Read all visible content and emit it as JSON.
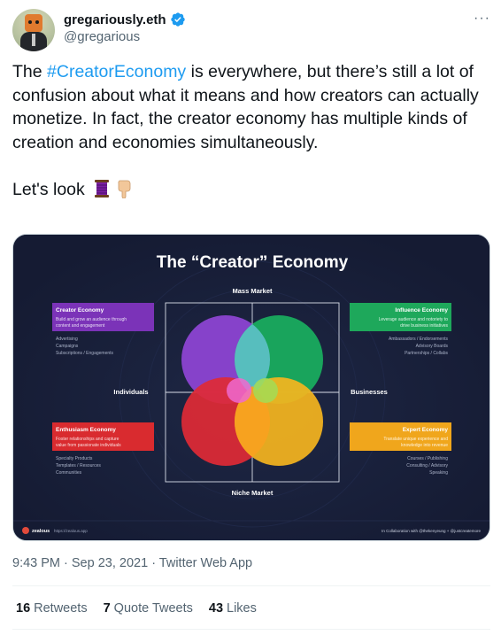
{
  "user": {
    "display_name": "gregariously.eth",
    "handle": "@gregarious"
  },
  "tweet": {
    "text_before": "The ",
    "hashtag": "#CreatorEconomy",
    "text_after": " is everywhere, but there’s still a lot of confusion about what it means and how creators can actually monetize.   In fact, the creator economy has multiple kinds of creation and economies simultaneously.",
    "closing": "Let's look"
  },
  "graphic": {
    "title": "The “Creator” Economy",
    "axis_top": "Mass Market",
    "axis_bottom": "Niche Market",
    "axis_left": "Individuals",
    "axis_right": "Businesses",
    "quadrants": {
      "top_left": {
        "title": "Creator Economy",
        "desc": [
          "Build and grow an audience through",
          "content and engagement"
        ],
        "items": [
          "Advertising",
          "Campaigns",
          "Subscriptions / Engagements"
        ],
        "color": "#7b33b8"
      },
      "top_right": {
        "title": "Influence Economy",
        "desc": [
          "Leverage audience and notoriety to",
          "drive business initiatives"
        ],
        "items": [
          "Ambassadors / Endorsements",
          "Advisory Boards",
          "Partnerships / Collabs"
        ],
        "color": "#1ea85b"
      },
      "bottom_left": {
        "title": "Enthusiasm Economy",
        "desc": [
          "Foster relationships and capture",
          "value from passionate individuals"
        ],
        "items": [
          "Specialty Products",
          "Templates / Resources",
          "Communities"
        ],
        "color": "#d92b2f"
      },
      "bottom_right": {
        "title": "Expert Economy",
        "desc": [
          "Translate unique experience and",
          "knowledge into revenue"
        ],
        "items": [
          "Courses / Publishing",
          "Consulting / Advisory",
          "Speaking"
        ],
        "color": "#f0a61c"
      }
    },
    "footer_brand": "zealous",
    "footer_url": "https://zealous.app",
    "footer_credit": "In Collaboration with @thekenyeung + @justcreatemore"
  },
  "meta": {
    "time": "9:43 PM",
    "sep": " · ",
    "date": "Sep 23, 2021",
    "source": "Twitter Web App"
  },
  "stats": {
    "retweets_count": "16",
    "retweets_label": "Retweets",
    "quotes_count": "7",
    "quotes_label": "Quote Tweets",
    "likes_count": "43",
    "likes_label": "Likes"
  },
  "icons": {
    "verified": "verified-badge-icon",
    "more": "more-options-icon",
    "emoji_1": "thread-spool-emoji",
    "emoji_2": "backhand-index-pointing-down-emoji"
  },
  "colors": {
    "link": "#1d9bf0",
    "secondary_text": "#536471",
    "graphic_background": "#161d36"
  }
}
